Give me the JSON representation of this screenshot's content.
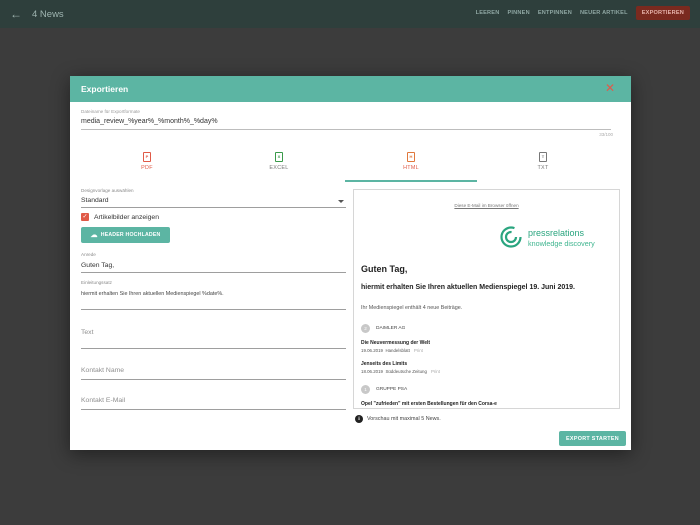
{
  "appbar": {
    "title": "4 News",
    "menu": [
      "LEEREN",
      "PINNEN",
      "ENTPINNEN",
      "NEUER ARTIKEL"
    ],
    "export_label": "EXPORTIEREN",
    "back_icon": "arrow-left-icon"
  },
  "dialog": {
    "title": "Exportieren",
    "filename": {
      "label": "Dateiname für Exportformate",
      "value": "media_review_%year%_%month%_%day%",
      "counter": "33/100"
    },
    "tabs": [
      {
        "label": "PDF",
        "icon": "P"
      },
      {
        "label": "EXCEL",
        "icon": "X"
      },
      {
        "label": "HTML",
        "icon": "H"
      },
      {
        "label": "TXT",
        "icon": "T"
      }
    ],
    "active_tab": "HTML",
    "form": {
      "template_label": "Designvorlage auswählen",
      "template_value": "Standard",
      "show_images_label": "Artikelbilder anzeigen",
      "show_images_checked": true,
      "upload_label": "HEADER HOCHLADEN",
      "salutation_label": "Anrede",
      "salutation_value": "Guten Tag,",
      "intro_label": "Einleitungssatz",
      "intro_value": "hiermit erhalten Sie Ihren aktuellen Medienspiegel %date%.",
      "text_placeholder": "Text",
      "contact_name_placeholder": "Kontakt Name",
      "contact_email_placeholder": "Kontakt E-Mail"
    },
    "preview": {
      "browser_link": "Diese E-Mail im Browser öffnen",
      "logo_name": "pressrelations",
      "logo_tagline": "knowledge discovery",
      "greeting": "Guten Tag,",
      "intro": "hiermit erhalten Sie Ihren aktuellen Medienspiegel 19. Juni 2019.",
      "count_text": "Ihr Medienspiegel enthält 4 neue Beiträge.",
      "categories": [
        {
          "num": "2",
          "name": "DAIMLER AG",
          "articles": [
            {
              "title": "Die Neuvermessung der Welt",
              "date": "19.06.2019",
              "source": "Handelsblatt",
              "media": "Print"
            },
            {
              "title": "Jenseits des Limits",
              "date": "18.06.2019",
              "source": "Süddeutsche Zeitung",
              "media": "Print"
            }
          ]
        },
        {
          "num": "1",
          "name": "GRUPPE PSA",
          "articles": [
            {
              "title": "Opel \"zufrieden\" mit ersten Bestellungen für den Corsa-e",
              "date": "",
              "source": "",
              "media": ""
            }
          ]
        }
      ],
      "note": "Vorschau mit maximal 5 News."
    },
    "export_button": "EXPORT STARTEN"
  },
  "colors": {
    "accent": "#5cb5a3",
    "danger": "#e05a47",
    "brand_green": "#2aa57f"
  }
}
